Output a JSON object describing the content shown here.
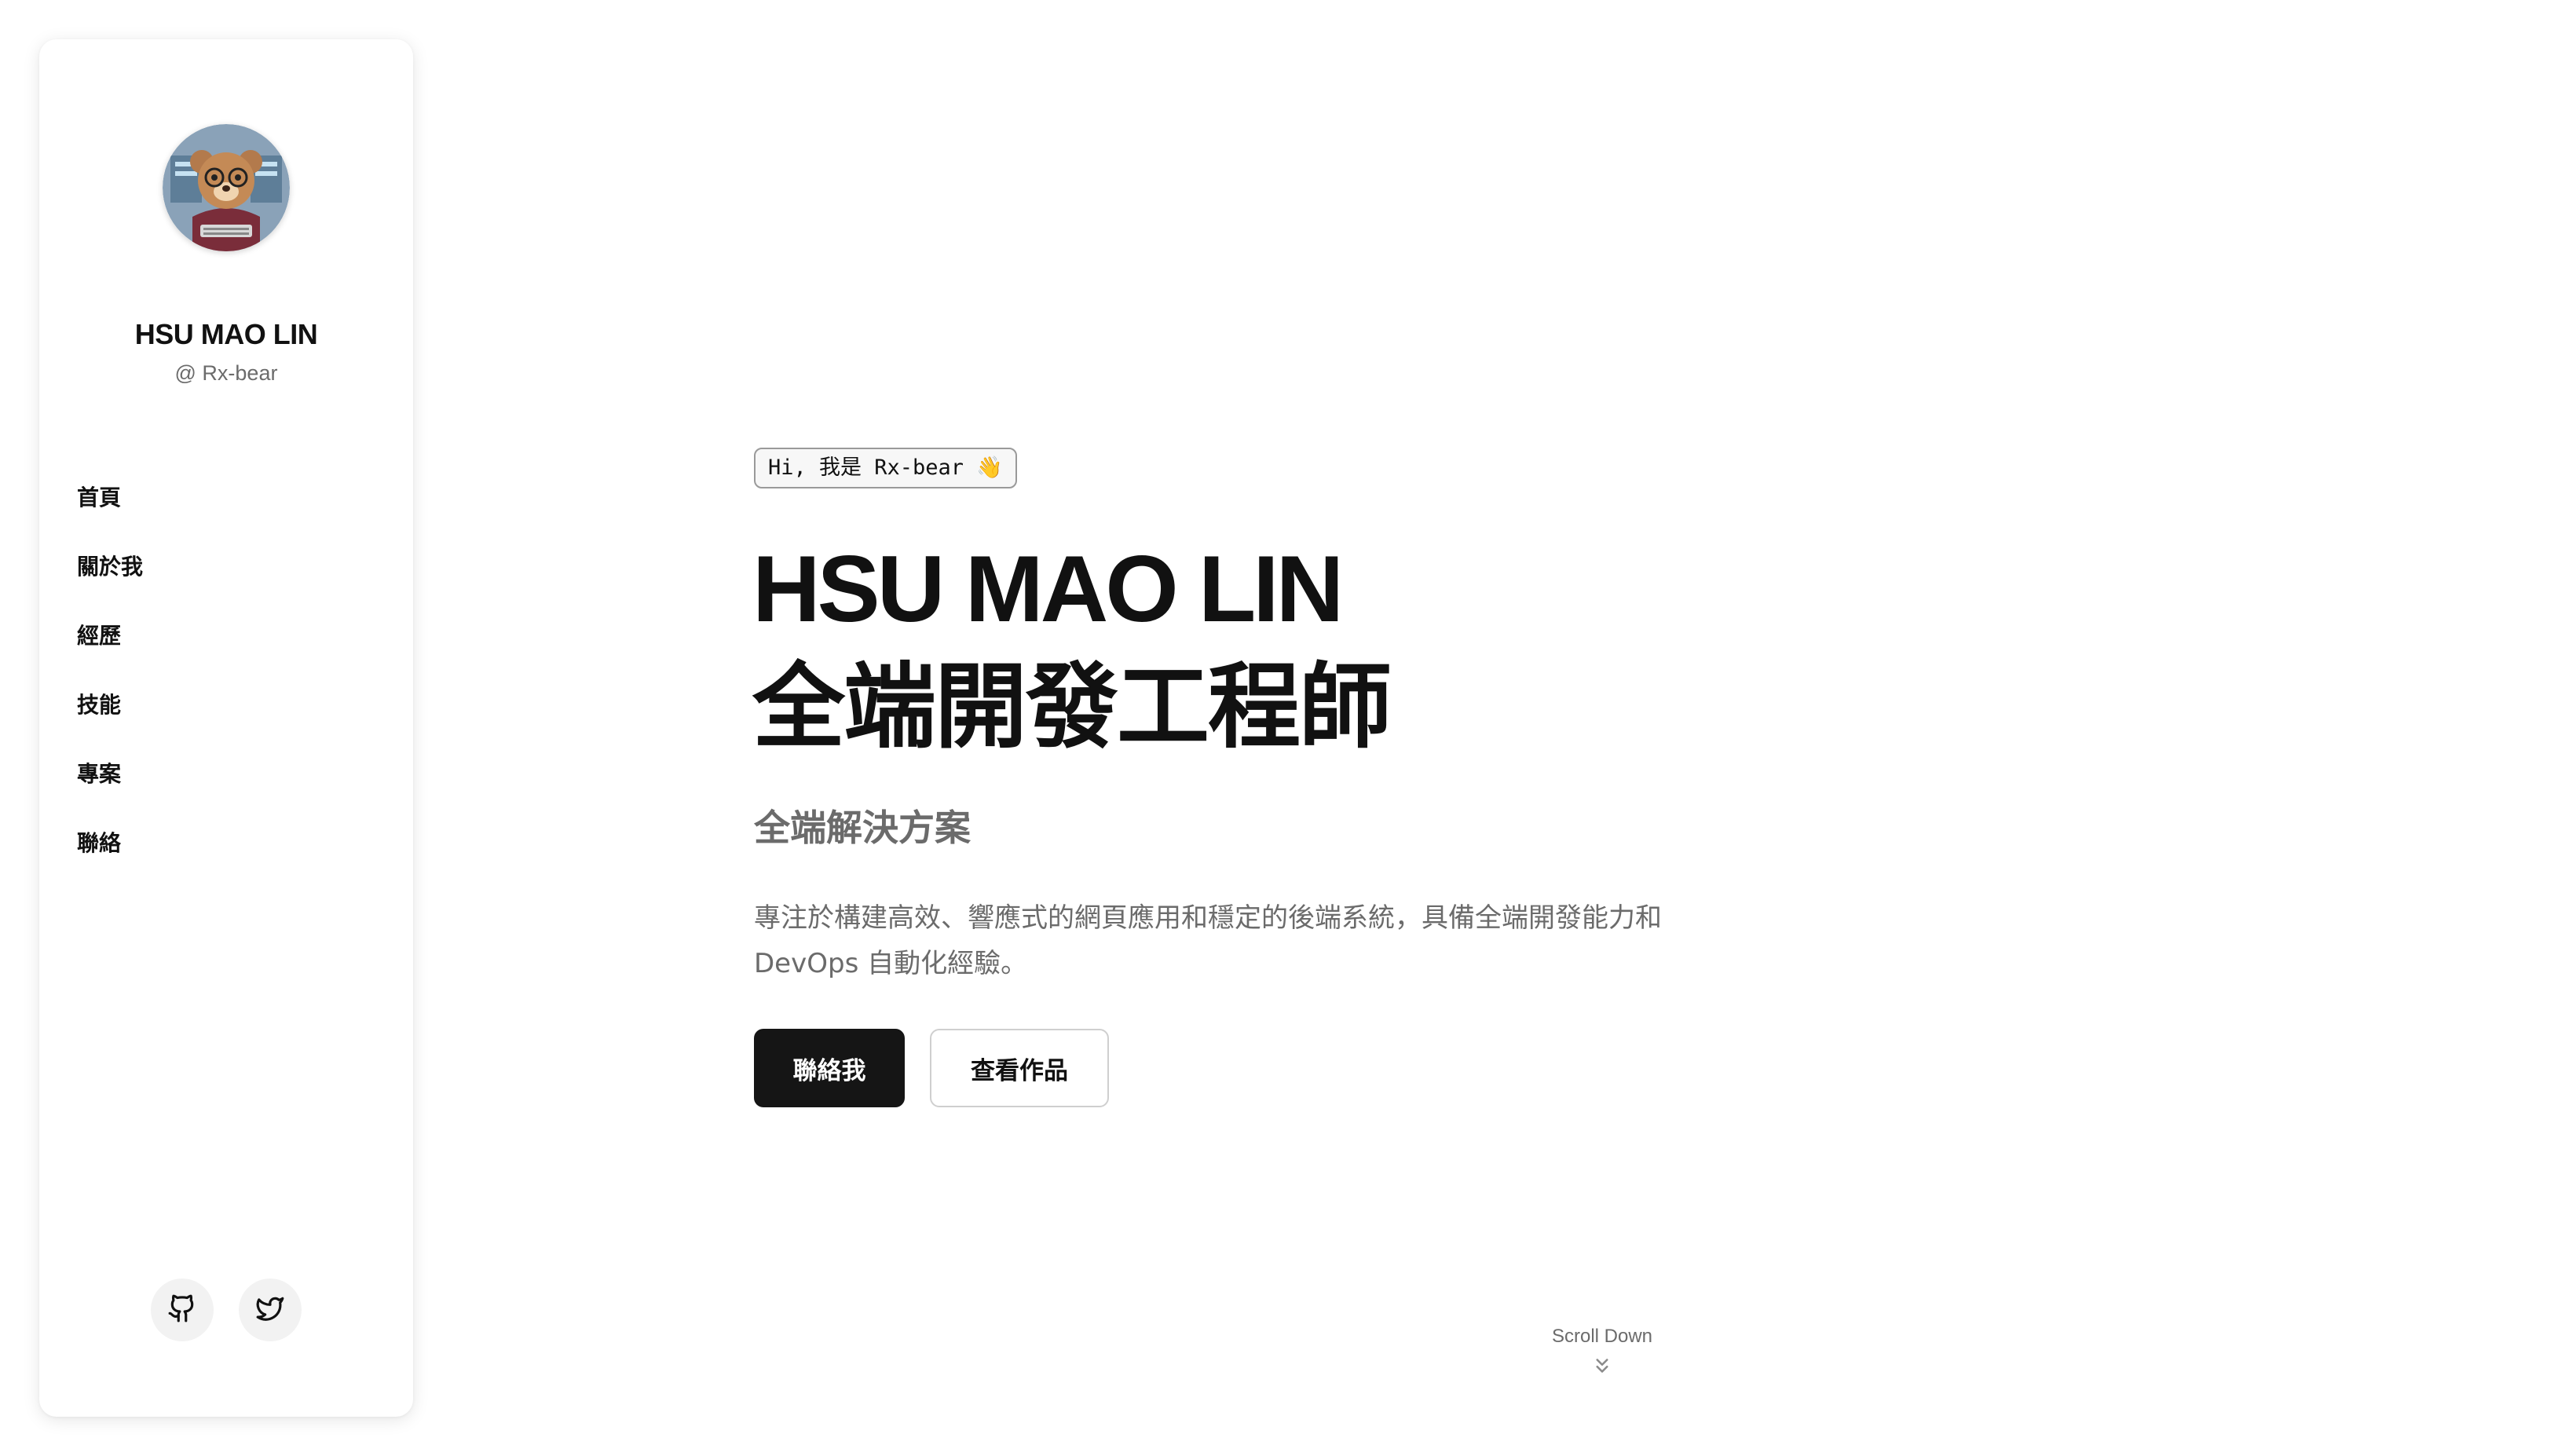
{
  "sidebar": {
    "profile": {
      "name": "HSU MAO LIN",
      "handle": "@ Rx-bear"
    },
    "nav": [
      {
        "label": "首頁"
      },
      {
        "label": "關於我"
      },
      {
        "label": "經歷"
      },
      {
        "label": "技能"
      },
      {
        "label": "專案"
      },
      {
        "label": "聯絡"
      }
    ],
    "social": [
      {
        "icon": "github-icon"
      },
      {
        "icon": "twitter-icon"
      }
    ]
  },
  "hero": {
    "greeting": "Hi, 我是 Rx-bear 👋",
    "name": "HSU MAO LIN",
    "role": "全端開發工程師",
    "subtitle": "全端解決方案",
    "description": "專注於構建高效、響應式的網頁應用和穩定的後端系統，具備全端開發能力和 DevOps 自動化經驗。",
    "primary_button": "聯絡我",
    "secondary_button": "查看作品"
  },
  "scroll": {
    "label": "Scroll Down",
    "icon": "chevrons-down-icon"
  },
  "colors": {
    "primary_button_bg": "#151515",
    "muted_text": "#6b6b6b",
    "heading_text": "#111111"
  }
}
